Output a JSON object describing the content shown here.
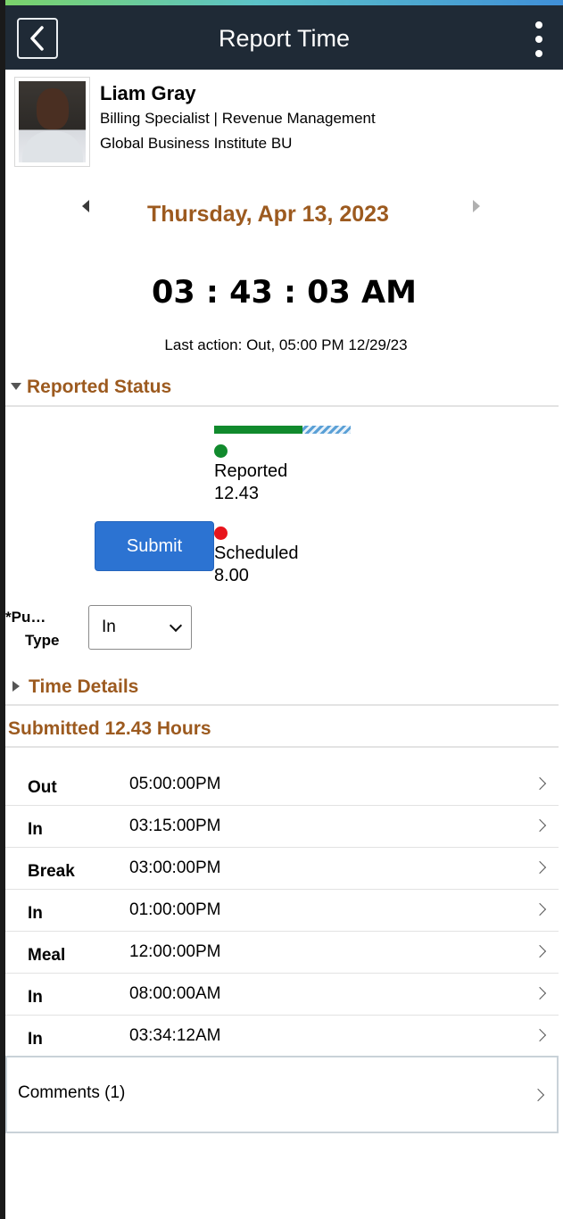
{
  "header": {
    "title": "Report Time"
  },
  "employee": {
    "name": "Liam Gray",
    "job": "Billing Specialist | Revenue Management",
    "business_unit": "Global Business Institute BU"
  },
  "date": {
    "label": "Thursday, Apr 13, 2023"
  },
  "clock": {
    "time": "03 : 43 : 03 AM",
    "last_action": "Last action: Out, 05:00 PM 12/29/23"
  },
  "reported_status": {
    "title": "Reported Status",
    "reported_fraction_of_bar": 0.65,
    "reported_label": "Reported",
    "reported_value": "12.43",
    "reported_color": "#118a2d",
    "scheduled_label": "Scheduled",
    "scheduled_value": "8.00",
    "scheduled_color": "#e8141c"
  },
  "actions": {
    "submit_label": "Submit"
  },
  "punch": {
    "label_line1": "*Pu…",
    "label_line2": "Type",
    "selected": "In"
  },
  "time_details": {
    "title": "Time Details"
  },
  "submitted": {
    "title": "Submitted 12.43 Hours"
  },
  "punches": [
    {
      "type": "Out",
      "time": "05:00:00PM"
    },
    {
      "type": "In",
      "time": "03:15:00PM"
    },
    {
      "type": "Break",
      "time": "03:00:00PM"
    },
    {
      "type": "In",
      "time": "01:00:00PM"
    },
    {
      "type": "Meal",
      "time": "12:00:00PM"
    },
    {
      "type": "In",
      "time": "08:00:00AM"
    },
    {
      "type": "In",
      "time": "03:34:12AM"
    }
  ],
  "comments": {
    "label": "Comments (1)"
  },
  "colors": {
    "accent": "#9c5a1f",
    "header_bg": "#1f2a36",
    "button": "#2c73d2"
  }
}
